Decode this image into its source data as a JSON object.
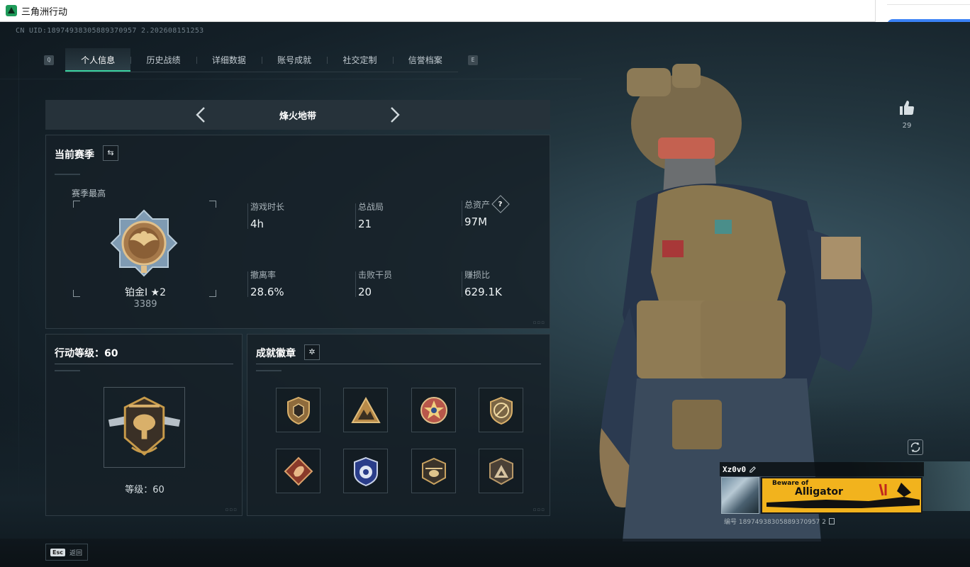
{
  "window": {
    "title": "三角洲行动"
  },
  "profile": {
    "uid_line": "CN UID:18974938305889370957 2.202608151253"
  },
  "tabs": [
    {
      "label": "个人信息",
      "active": true
    },
    {
      "label": "历史战绩",
      "active": false
    },
    {
      "label": "详细数据",
      "active": false
    },
    {
      "label": "账号成就",
      "active": false
    },
    {
      "label": "社交定制",
      "active": false
    },
    {
      "label": "信誉档案",
      "active": false
    }
  ],
  "tab_keys": {
    "left": "Q",
    "right": "E"
  },
  "mode_selector": {
    "title": "烽火地带"
  },
  "season": {
    "title": "当前赛季",
    "best_label": "赛季最高",
    "rank_name": "铂金Ⅰ ★2",
    "rank_score": "3389",
    "stats": [
      {
        "label": "游戏时长",
        "value": "4h"
      },
      {
        "label": "总战局",
        "value": "21"
      },
      {
        "label": "总资产",
        "value": "97M"
      },
      {
        "label": "撤离率",
        "value": "28.6%"
      },
      {
        "label": "击败干员",
        "value": "20"
      },
      {
        "label": "赚损比",
        "value": "629.1K"
      }
    ]
  },
  "level": {
    "title": "行动等级：60",
    "caption": "等级：60"
  },
  "badges": {
    "title": "成就徽章",
    "items": [
      {
        "icon": "shield-emblem-icon"
      },
      {
        "icon": "mountain-emblem-icon"
      },
      {
        "icon": "star-cross-emblem-icon"
      },
      {
        "icon": "no-weapon-emblem-icon"
      },
      {
        "icon": "dragon-emblem-icon"
      },
      {
        "icon": "police-emblem-icon"
      },
      {
        "icon": "helicopter-emblem-icon"
      },
      {
        "icon": "triangle-emblem-icon"
      }
    ]
  },
  "likes": {
    "count": "29"
  },
  "namecard": {
    "nickname": "Xz0v0",
    "plate_top": "Beware of",
    "plate_main": "Alligator",
    "id_line": "编号 18974938305889370957 2"
  },
  "bottom": {
    "esc_key": "Esc",
    "esc_label": "返回"
  },
  "colors": {
    "accent": "#3ad1a0",
    "plate": "#f2b31d",
    "gold": "#c89b4a"
  }
}
